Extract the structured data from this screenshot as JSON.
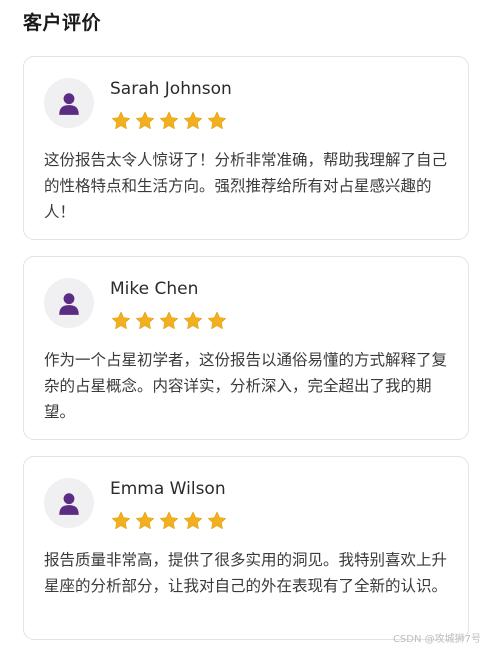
{
  "section": {
    "title": "客户评价"
  },
  "reviews": [
    {
      "name": "Sarah Johnson",
      "rating": 5,
      "text": "这份报告太令人惊讶了！分析非常准确，帮助我理解了自己的性格特点和生活方向。强烈推荐给所有对占星感兴趣的人！"
    },
    {
      "name": "Mike Chen",
      "rating": 5,
      "text": "作为一个占星初学者，这份报告以通俗易懂的方式解释了复杂的占星概念。内容详实，分析深入，完全超出了我的期望。"
    },
    {
      "name": "Emma Wilson",
      "rating": 5,
      "text": "报告质量非常高，提供了很多实用的洞见。我特别喜欢上升星座的分析部分，让我对自己的外在表现有了全新的认识。"
    }
  ],
  "icons": {
    "avatar": "user-icon",
    "star": "star-icon"
  },
  "colors": {
    "avatar_icon": "#5b2d82",
    "avatar_bg": "#f0eff1",
    "star": "#f2b01e"
  },
  "watermark": "CSDN @攻城狮7号"
}
